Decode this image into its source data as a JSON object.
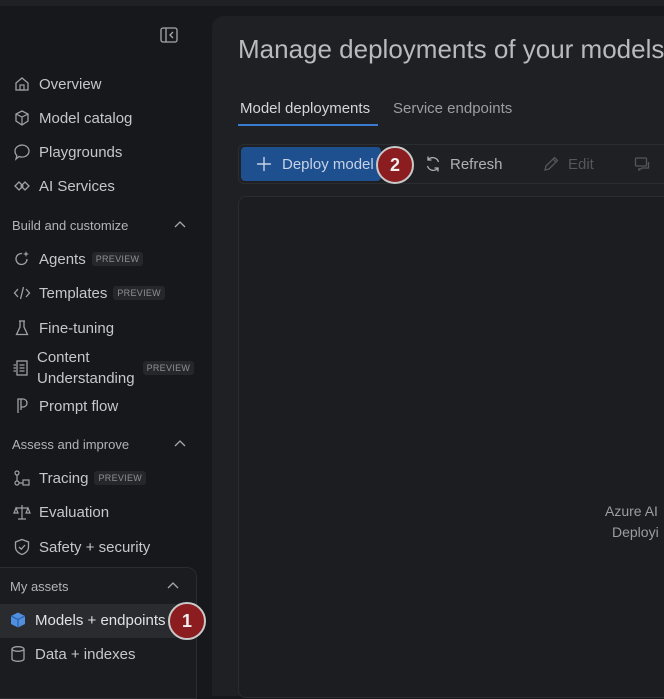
{
  "sidebar": {
    "items": [
      {
        "label": "Overview"
      },
      {
        "label": "Model catalog"
      },
      {
        "label": "Playgrounds"
      },
      {
        "label": "AI Services"
      }
    ],
    "build_section": "Build and customize",
    "build_items": [
      {
        "label": "Agents",
        "badge": "PREVIEW"
      },
      {
        "label": "Templates",
        "badge": "PREVIEW"
      },
      {
        "label": "Fine-tuning"
      },
      {
        "label_line1": "Content",
        "label_line2": "Understanding",
        "badge": "PREVIEW"
      },
      {
        "label": "Prompt flow"
      }
    ],
    "assess_section": "Assess and improve",
    "assess_items": [
      {
        "label": "Tracing",
        "badge": "PREVIEW"
      },
      {
        "label": "Evaluation"
      },
      {
        "label": "Safety + security"
      }
    ],
    "assets_section": "My assets",
    "assets_items": [
      {
        "label": "Models + endpoints"
      },
      {
        "label": "Data + indexes"
      }
    ]
  },
  "main": {
    "title": "Manage deployments of your models",
    "tabs": [
      {
        "label": "Model deployments"
      },
      {
        "label": "Service endpoints"
      }
    ],
    "toolbar": {
      "deploy_label": "Deploy model",
      "refresh_label": "Refresh",
      "edit_label": "Edit"
    },
    "empty_state": {
      "line1": "Azure AI",
      "line2": "Deployi"
    }
  },
  "annotations": {
    "step1": "1",
    "step2": "2"
  },
  "colors": {
    "accent": "#3b7ad1",
    "deploy_button": "#1e4f8f",
    "step_marker": "#8b1c1f"
  }
}
